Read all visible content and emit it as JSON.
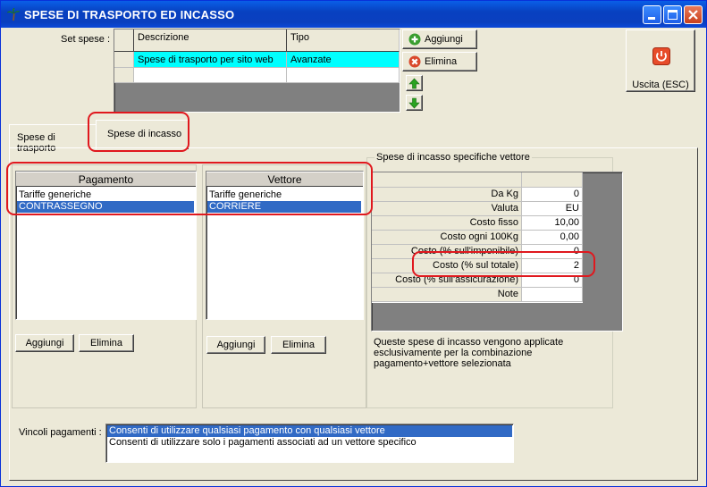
{
  "window": {
    "title": "SPESE DI TRASPORTO ED INCASSO",
    "accent": "#0a3fbf"
  },
  "set_spese": {
    "label": "Set spese :",
    "columns": [
      "Descrizione",
      "Tipo"
    ],
    "rows": [
      {
        "descrizione": "Spese di trasporto per sito web",
        "tipo": "Avanzate",
        "selected": true
      }
    ],
    "add_label": "Aggiungi",
    "delete_label": "Elimina"
  },
  "exit_button": {
    "label": "Uscita (ESC)"
  },
  "tabs": [
    {
      "label": "Spese di trasporto",
      "active": false
    },
    {
      "label": "Spese di incasso",
      "active": true
    }
  ],
  "pagamento": {
    "header": "Pagamento",
    "items": [
      "Tariffe generiche",
      "CONTRASSEGNO"
    ],
    "selected_index": 1,
    "add_label": "Aggiungi",
    "delete_label": "Elimina"
  },
  "vettore": {
    "header": "Vettore",
    "items": [
      "Tariffe generiche",
      "CORRIERE"
    ],
    "selected_index": 1,
    "add_label": "Aggiungi",
    "delete_label": "Elimina"
  },
  "incasso": {
    "group_title": "Spese di incasso specifiche vettore",
    "rows": [
      {
        "label": "Da Kg",
        "value": "0"
      },
      {
        "label": "Valuta",
        "value": "EU"
      },
      {
        "label": "Costo fisso",
        "value": "10,00"
      },
      {
        "label": "Costo ogni 100Kg",
        "value": "0,00"
      },
      {
        "label": "Costo (% sull'imponibile)",
        "value": "0"
      },
      {
        "label": "Costo (% sul totale)",
        "value": "2"
      },
      {
        "label": "Costo (% sull'assicurazione)",
        "value": "0"
      },
      {
        "label": "Note",
        "value": ""
      }
    ],
    "note": "Queste spese di incasso vengono applicate esclusivamente per la combinazione pagamento+vettore selezionata"
  },
  "vincoli": {
    "label": "Vincoli pagamenti :",
    "options": [
      "Consenti di utilizzare qualsiasi pagamento con qualsiasi vettore",
      "Consenti di utilizzare solo i pagamenti associati ad un vettore specifico"
    ],
    "selected_index": 0
  },
  "colors": {
    "selection": "#316ac5",
    "set_selection": "#00ffff",
    "highlight": "#e0181e"
  }
}
